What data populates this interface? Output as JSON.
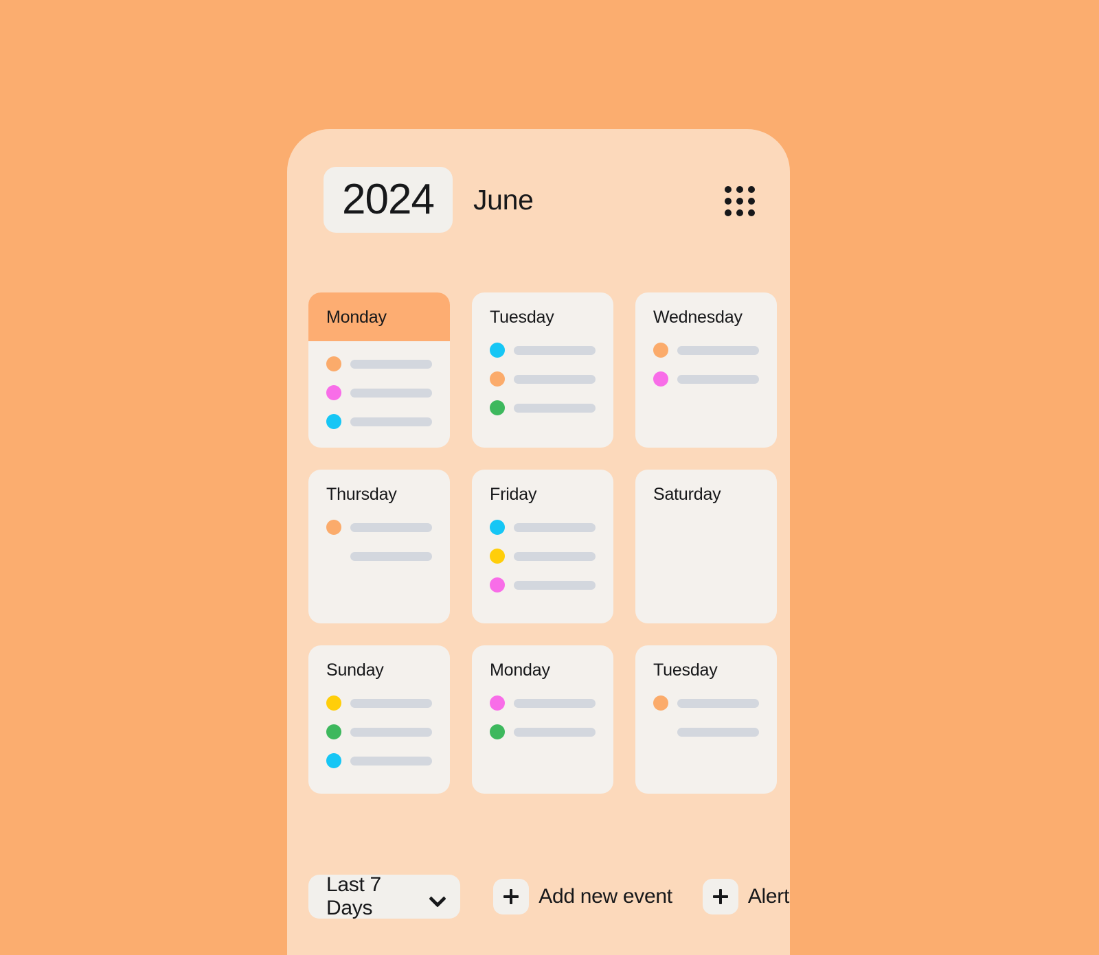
{
  "theme": {
    "page_background": "#FBAD6F",
    "phone_background": "#FCD9BB",
    "card_background": "#F4F1ED",
    "chip_background": "#F2F0EC",
    "highlight_background": "#FDAD72",
    "bar_color": "#D3D7DE",
    "text_color": "#17181A"
  },
  "header": {
    "year": "2024",
    "month": "June",
    "menu_icon": "grid-dots-icon"
  },
  "calendar": {
    "rows": [
      {
        "cards": [
          {
            "day": "Monday",
            "highlighted": true,
            "events": [
              {
                "dot": "#FBAB6B"
              },
              {
                "dot": "#F86DE8"
              },
              {
                "dot": "#16C6F5"
              }
            ]
          },
          {
            "day": "Tuesday",
            "highlighted": false,
            "events": [
              {
                "dot": "#16C6F5"
              },
              {
                "dot": "#FBAB6B"
              },
              {
                "dot": "#3DB85D"
              }
            ]
          },
          {
            "day": "Wednesday",
            "highlighted": false,
            "events": [
              {
                "dot": "#FBAB6B"
              },
              {
                "dot": "#F86DE8"
              }
            ]
          }
        ]
      },
      {
        "cards": [
          {
            "day": "Thursday",
            "highlighted": false,
            "events": [
              {
                "dot": "#FBAB6B"
              },
              {
                "dot": null
              }
            ]
          },
          {
            "day": "Friday",
            "highlighted": false,
            "events": [
              {
                "dot": "#16C6F5"
              },
              {
                "dot": "#FFCE0A"
              },
              {
                "dot": "#F86DE8"
              }
            ]
          },
          {
            "day": "Saturday",
            "highlighted": false,
            "events": []
          }
        ]
      },
      {
        "cards": [
          {
            "day": "Sunday",
            "highlighted": false,
            "events": [
              {
                "dot": "#FFCE0A"
              },
              {
                "dot": "#3DB85D"
              },
              {
                "dot": "#16C6F5"
              }
            ]
          },
          {
            "day": "Monday",
            "highlighted": false,
            "events": [
              {
                "dot": "#F86DE8"
              },
              {
                "dot": "#3DB85D"
              }
            ]
          },
          {
            "day": "Tuesday",
            "highlighted": false,
            "events": [
              {
                "dot": "#FBAB6B"
              },
              {
                "dot": null
              }
            ]
          }
        ]
      }
    ]
  },
  "toolbar": {
    "range_value": "Last 7 Days",
    "range_chevron_icon": "chevron-down-icon",
    "add_event_label": "Add new event",
    "add_event_icon": "plus-icon",
    "alert_label": "Alert",
    "alert_icon": "plus-icon"
  }
}
